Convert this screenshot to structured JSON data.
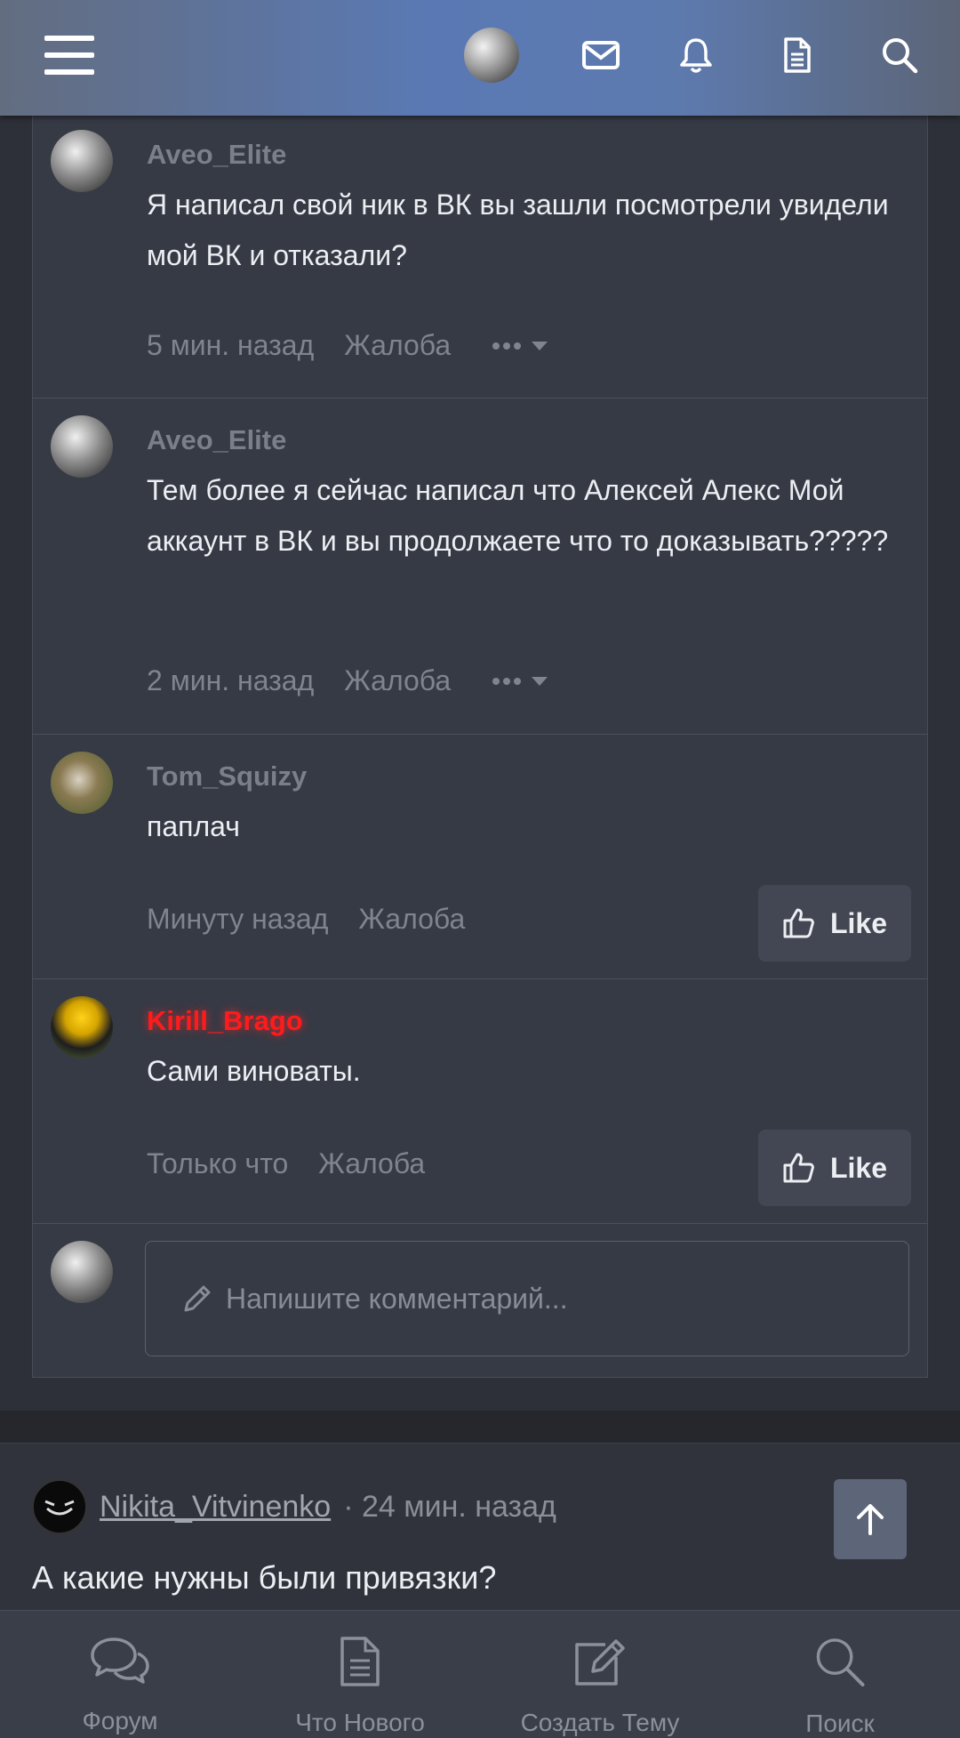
{
  "comments": [
    {
      "user": "Aveo_Elite",
      "text": "Я написал свой ник в ВК вы зашли посмотрели увидели мой ВК и отказали?",
      "time": "5 мин. назад",
      "report": "Жалоба"
    },
    {
      "user": "Aveo_Elite",
      "text": "Тем более я сейчас написал что Алексей Алекс Мой аккаунт в ВК и вы продолжаете что то доказывать?????",
      "time": "2 мин. назад",
      "report": "Жалоба"
    },
    {
      "user": "Tom_Squizy",
      "text": "паплач",
      "time": "Минуту назад",
      "report": "Жалоба",
      "like": "Like"
    },
    {
      "user": "Kirill_Brago",
      "text": "Сами виноваты.",
      "time": "Только что",
      "report": "Жалоба",
      "like": "Like",
      "user_color": "#ff1b1b"
    }
  ],
  "reply": {
    "placeholder": "Напишите комментарий..."
  },
  "post": {
    "author": "Nikita_Vitvinenko",
    "time": "· 24 мин. назад",
    "text": "А какие нужны были привязки?"
  },
  "nav": {
    "forum": "Форум",
    "whats_new": "Что Нового",
    "create_thread": "Создать Тему",
    "search": "Поиск"
  },
  "icons": [
    "menu-icon",
    "mail-icon",
    "bell-icon",
    "document-icon",
    "search-icon",
    "pencil-icon",
    "thumbs-up-icon",
    "arrow-up-icon",
    "chat-bubbles-icon",
    "edit-icon"
  ]
}
